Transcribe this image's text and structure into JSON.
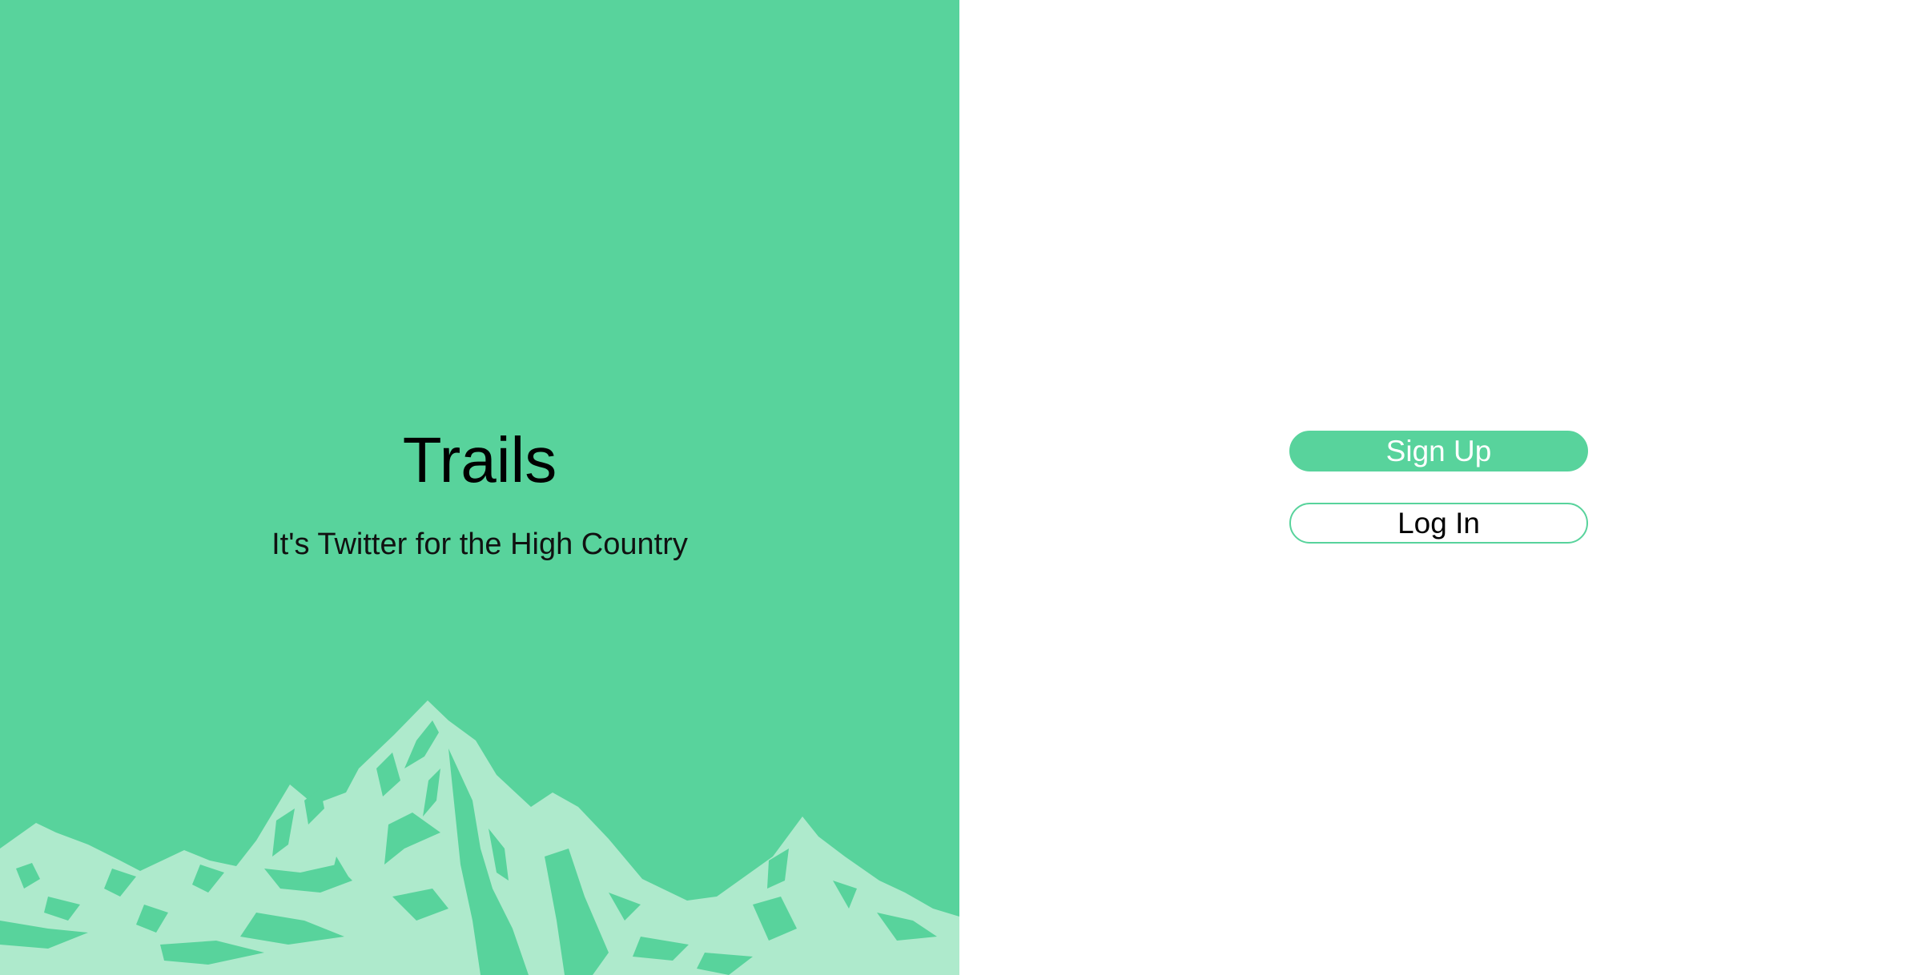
{
  "hero": {
    "title": "Trails",
    "subtitle": "It's Twitter for the High Country",
    "background_color": "#58d39c",
    "illustration": "mountain-range",
    "illustration_color": "#aeeacc"
  },
  "auth": {
    "signup_label": "Sign Up",
    "login_label": "Log In",
    "accent_color": "#58d39c"
  }
}
